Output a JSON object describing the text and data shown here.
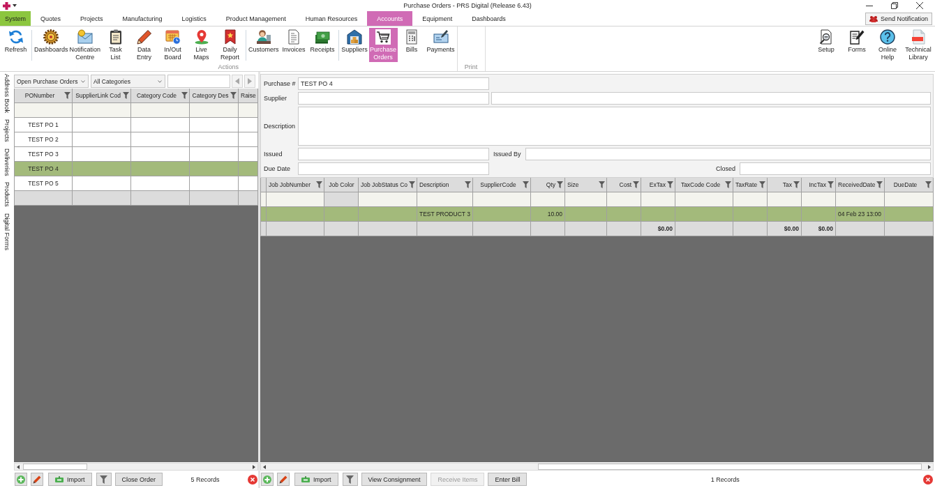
{
  "window": {
    "title": "Purchase Orders - PRS Digital (Release 6.43)"
  },
  "menu": {
    "app_button": {
      "label": "System"
    },
    "tabs": [
      {
        "label": "Quotes",
        "selected": false
      },
      {
        "label": "Projects",
        "selected": false
      },
      {
        "label": "Manufacturing",
        "selected": false
      },
      {
        "label": "Logistics",
        "selected": false
      },
      {
        "label": "Product Management",
        "selected": false
      },
      {
        "label": "Human Resources",
        "selected": false
      },
      {
        "label": "Accounts",
        "selected": true
      },
      {
        "label": "Equipment",
        "selected": false
      },
      {
        "label": "Dashboards",
        "selected": false
      }
    ],
    "notify_button": {
      "label": "Send Notification"
    }
  },
  "ribbon": {
    "groups": [
      {
        "label": "Actions",
        "sections": [
          {
            "buttons": [
              {
                "label": "Refresh",
                "selected": false
              }
            ]
          },
          {
            "buttons": [
              {
                "label": "Dashboards",
                "selected": false
              },
              {
                "label": "Notification Centre",
                "selected": false
              },
              {
                "label": "Task List",
                "selected": false
              },
              {
                "label": "Data Entry",
                "selected": false
              },
              {
                "label": "In/Out Board",
                "selected": false
              },
              {
                "label": "Live Maps",
                "selected": false
              },
              {
                "label": "Daily Report",
                "selected": false
              }
            ]
          },
          {
            "buttons": [
              {
                "label": "Customers",
                "selected": false
              },
              {
                "label": "Invoices",
                "selected": false
              },
              {
                "label": "Receipts",
                "selected": false
              }
            ]
          },
          {
            "buttons": [
              {
                "label": "Suppliers",
                "selected": false
              },
              {
                "label": "Purchase Orders",
                "selected": true
              },
              {
                "label": "Bills",
                "selected": false
              },
              {
                "label": "Payments",
                "selected": false
              }
            ]
          }
        ]
      },
      {
        "label": "Print"
      }
    ],
    "right_buttons": [
      {
        "label": "Setup",
        "selected": false
      },
      {
        "label": "Forms",
        "selected": false
      },
      {
        "label": "Online Help",
        "selected": false
      },
      {
        "label": "Technical Library",
        "selected": false
      }
    ]
  },
  "side_tabs": [
    {
      "label": "Address Book"
    },
    {
      "label": "Projects"
    },
    {
      "label": "Deliveries"
    },
    {
      "label": "Products"
    },
    {
      "label": "Digital Forms"
    }
  ],
  "orders_panel": {
    "view_dropdown": {
      "value": "Open Purchase Orders"
    },
    "category_dropdown": {
      "value": "All Categories"
    },
    "grid": {
      "columns": [
        {
          "label": "PONumber",
          "kind": "key",
          "filter": true
        },
        {
          "label": "SupplierLink Cod",
          "kind": "key",
          "filter": true
        },
        {
          "label": "Category Code",
          "kind": "key",
          "filter": true
        },
        {
          "label": "Category Des",
          "kind": "key",
          "filter": true
        },
        {
          "label": "Raise",
          "kind": "text"
        }
      ],
      "rows": [
        {
          "po_number": "TEST PO 1",
          "selected": false
        },
        {
          "po_number": "TEST PO 2",
          "selected": false
        },
        {
          "po_number": "TEST PO 3",
          "selected": false
        },
        {
          "po_number": "TEST PO 4",
          "selected": true
        },
        {
          "po_number": "TEST PO 5",
          "selected": false
        }
      ]
    },
    "toolbar": {
      "import_button": {
        "label": "Import"
      },
      "actions": [
        {
          "label": "Close Order",
          "disabled": false
        }
      ],
      "records": "5 Records"
    }
  },
  "details_panel": {
    "form": {
      "purchase_number": {
        "label": "Purchase #",
        "value": "TEST PO 4"
      },
      "supplier": {
        "label": "Supplier"
      },
      "description": {
        "label": "Description"
      },
      "issued": {
        "label": "Issued"
      },
      "issued_by": {
        "label": "Issued By"
      },
      "due_date": {
        "label": "Due Date"
      },
      "closed": {
        "label": "Closed"
      }
    },
    "grid": {
      "columns": [
        {
          "kind": "text"
        },
        {
          "label": "Job JobNumber",
          "kind": "text",
          "filter": true
        },
        {
          "label": "Job Color",
          "kind": "color",
          "filter": false
        },
        {
          "label": "Job JobStatus Co",
          "kind": "text",
          "filter": true
        },
        {
          "label": "Description",
          "kind": "text",
          "filter": true
        },
        {
          "label": "SupplierCode",
          "kind": "key",
          "filter": true
        },
        {
          "label": "Qty",
          "kind": "number",
          "filter": true
        },
        {
          "label": "Size",
          "kind": "text",
          "filter": true
        },
        {
          "label": "Cost",
          "kind": "number",
          "filter": true
        },
        {
          "label": "ExTax",
          "kind": "number",
          "filter": true
        },
        {
          "label": "TaxCode Code",
          "kind": "key",
          "filter": true
        },
        {
          "label": "TaxRate",
          "kind": "text",
          "filter": true
        },
        {
          "label": "Tax",
          "kind": "number",
          "filter": true
        },
        {
          "label": "IncTax",
          "kind": "number",
          "filter": true
        },
        {
          "label": "ReceivedDate",
          "kind": "text",
          "filter": true
        },
        {
          "label": "DueDate",
          "kind": "key",
          "filter": true
        }
      ],
      "rows": [
        {
          "description": "TEST PRODUCT 3",
          "qty": "10.00",
          "received_date": "04 Feb 23 13:00",
          "selected": true
        }
      ],
      "totals": {
        "ex_tax": "$0.00",
        "tax": "$0.00",
        "inc_tax": "$0.00"
      }
    },
    "toolbar": {
      "import_button": {
        "label": "Import"
      },
      "actions": [
        {
          "label": "View Consignment",
          "disabled": false
        },
        {
          "label": "Receive Items",
          "disabled": true
        },
        {
          "label": "Enter Bill",
          "disabled": false
        }
      ],
      "records": "1 Records"
    }
  }
}
